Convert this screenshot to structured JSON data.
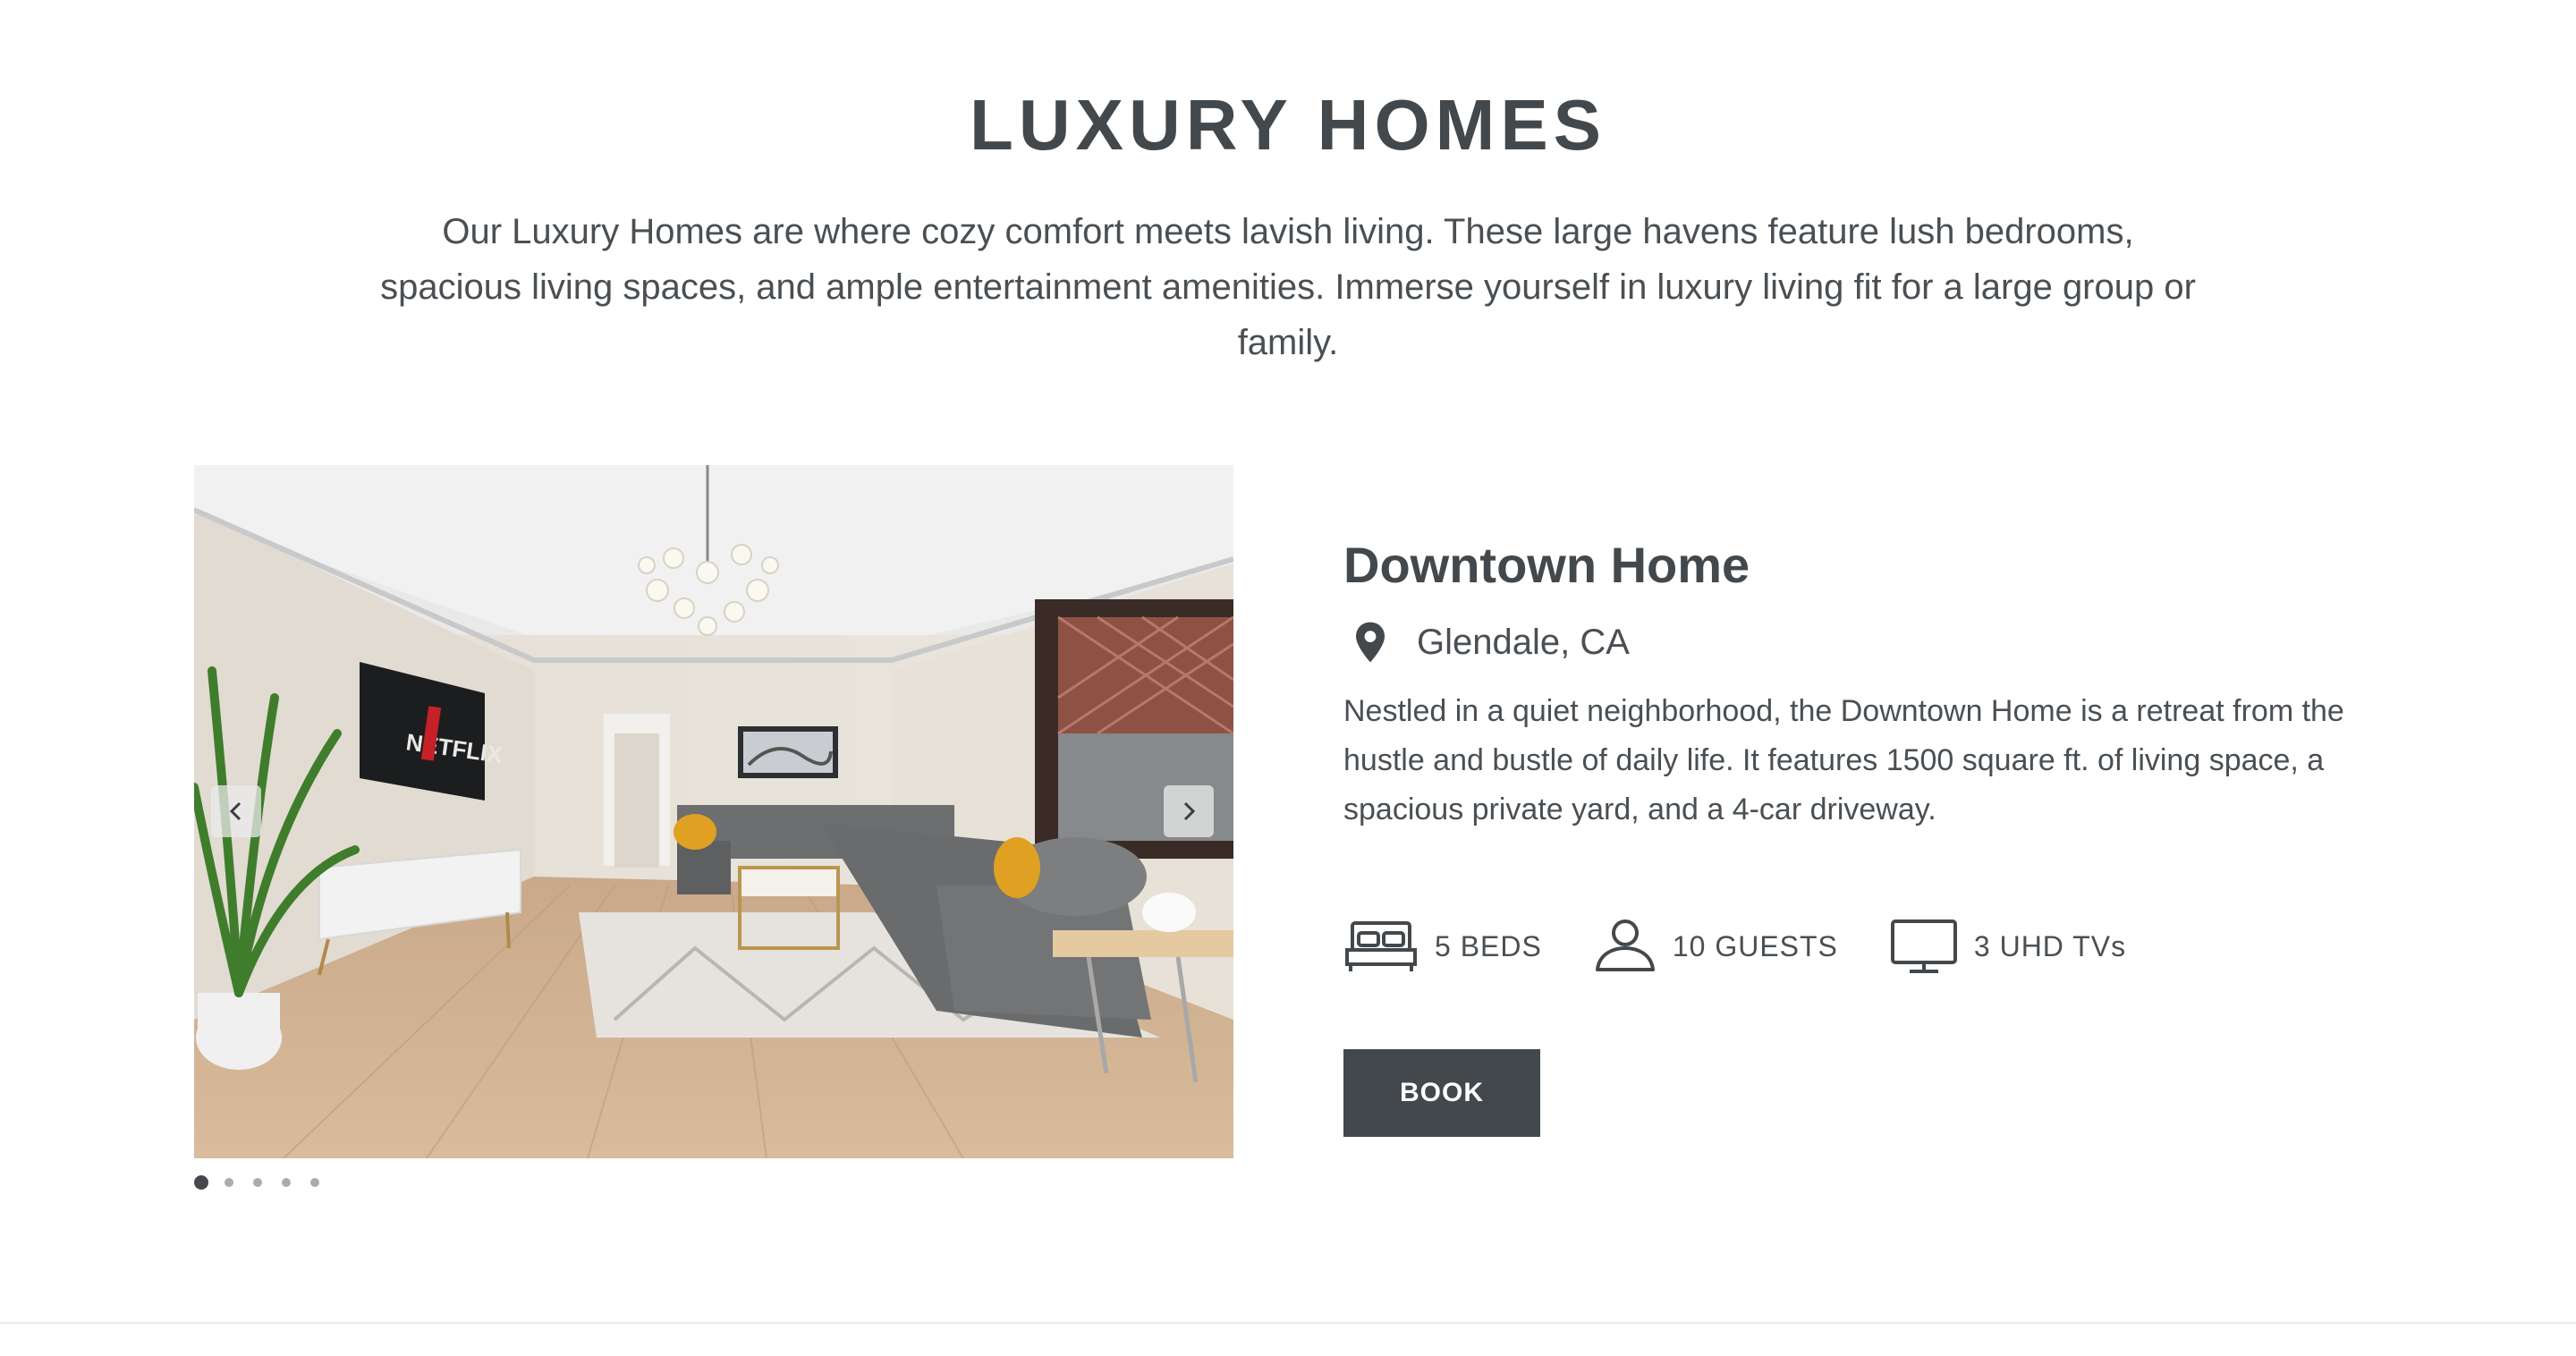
{
  "section": {
    "title": "LUXURY HOMES",
    "intro": "Our Luxury Homes are where cozy comfort meets lavish living. These large havens feature lush bedrooms, spacious living spaces, and ample entertainment amenities. Immerse yourself in luxury living fit for a large group or family."
  },
  "listing": {
    "name": "Downtown Home",
    "location": "Glendale, CA",
    "description": "Nestled in a quiet neighborhood, the Downtown Home is a retreat from the hustle and bustle of daily life. It features 1500 square ft. of living space, a spacious private yard, and a 4-car driveway.",
    "amenities": [
      {
        "icon": "bed-icon",
        "label": "5 BEDS"
      },
      {
        "icon": "person-icon",
        "label": "10 GUESTS"
      },
      {
        "icon": "tv-icon",
        "label": "3 UHD TVs"
      }
    ],
    "book_label": "BOOK"
  },
  "carousel": {
    "tv_logo": "NETFLIX",
    "slide_count": 5,
    "active_slide": 1
  },
  "colors": {
    "text": "#43484c",
    "button_bg": "#43484c",
    "button_text": "#ffffff"
  }
}
